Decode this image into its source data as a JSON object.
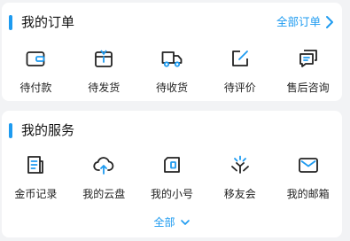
{
  "orders": {
    "title": "我的订单",
    "all_label": "全部订单",
    "items": [
      {
        "label": "待付款",
        "icon": "wallet-icon"
      },
      {
        "label": "待发货",
        "icon": "package-icon"
      },
      {
        "label": "待收货",
        "icon": "truck-icon"
      },
      {
        "label": "待评价",
        "icon": "edit-review-icon"
      },
      {
        "label": "售后咨询",
        "icon": "chat-bubble-icon"
      }
    ]
  },
  "services": {
    "title": "我的服务",
    "items": [
      {
        "label": "金币记录",
        "icon": "document-list-icon"
      },
      {
        "label": "我的云盘",
        "icon": "cloud-upload-icon"
      },
      {
        "label": "我的小号",
        "icon": "phone-card-icon"
      },
      {
        "label": "移友会",
        "icon": "community-icon"
      },
      {
        "label": "我的邮箱",
        "icon": "mail-icon"
      }
    ],
    "expand_label": "全部"
  },
  "colors": {
    "accent": "#1e9bf0",
    "background": "#f2f3f5",
    "card": "#ffffff"
  }
}
